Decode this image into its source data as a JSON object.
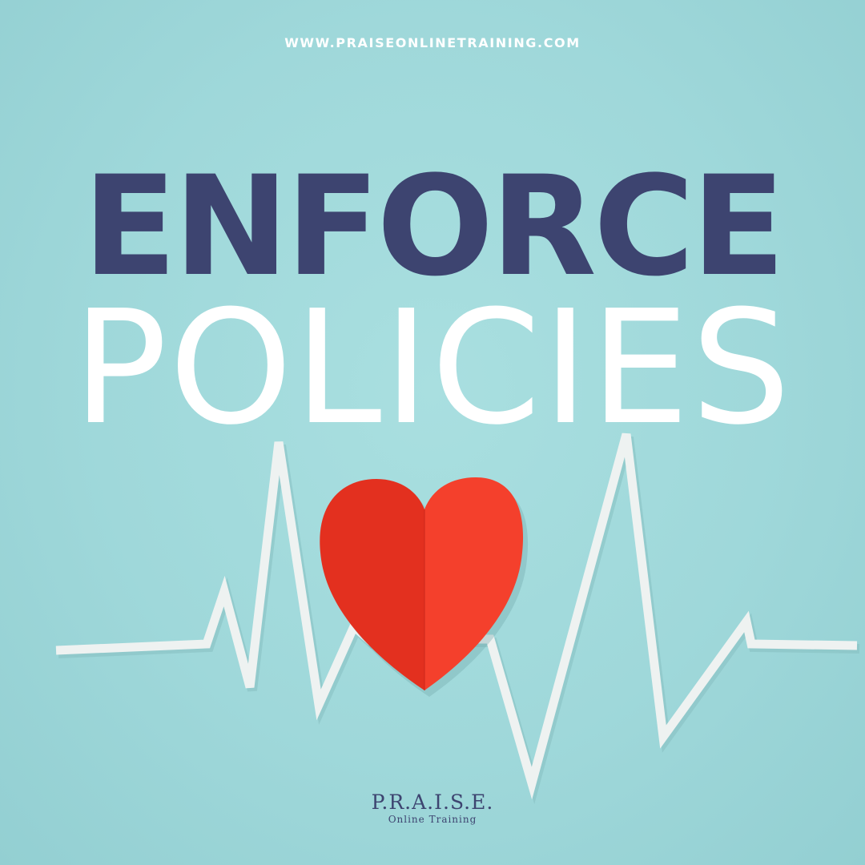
{
  "header": {
    "url": "WWW.PRAISEONLINETRAINING.COM"
  },
  "headline": {
    "line1": "ENFORCE",
    "line2": "POLICIES"
  },
  "logo": {
    "name": "P.R.A.I.S.E.",
    "tagline": "Online Training"
  },
  "colors": {
    "background": "#a3dadc",
    "headline_dark": "#3d4470",
    "heart": "#f2362a",
    "ecg_line": "#f1f3f2"
  },
  "illustration": {
    "icons": [
      "paper-heart-icon",
      "heartbeat-line-icon"
    ]
  }
}
